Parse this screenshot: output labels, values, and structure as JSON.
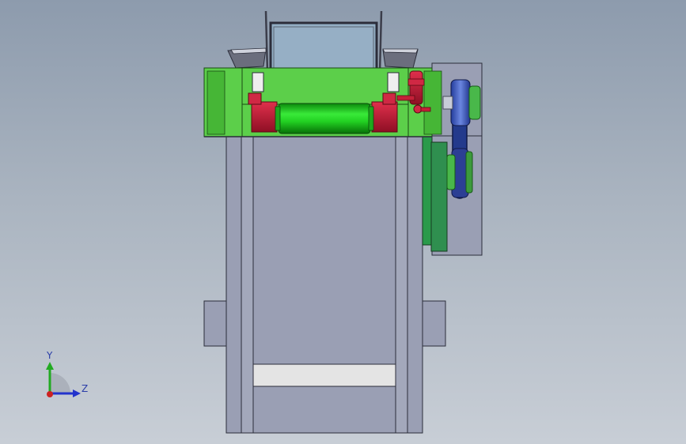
{
  "viewport": {
    "background_top": "#8d9bad",
    "background_bottom": "#c8ced6"
  },
  "model": {
    "frame_color": "#9a9fb4",
    "frame_edge_color": "#2b2d3a",
    "roller_color": "#22d022",
    "bearing_color": "#c8203a",
    "housing_color": "#5ccf4a",
    "pulley_color": "#4a66c8",
    "hopper_glass_color": "#93aec4"
  },
  "triad": {
    "y_label": "Y",
    "z_label": "Z",
    "y_color": "#22aa22",
    "z_color": "#2233cc",
    "x_color": "#cc2222"
  }
}
